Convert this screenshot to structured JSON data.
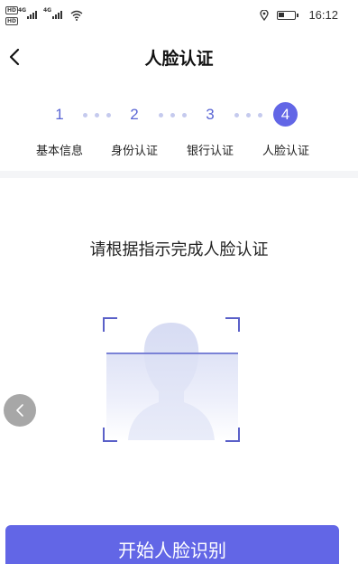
{
  "status_bar": {
    "hd_1": "HD",
    "hd_2": "HD",
    "network_1": "4G",
    "network_2": "4G",
    "time": "16:12",
    "icons": [
      "signal-icon",
      "wifi-icon",
      "location-icon",
      "battery-icon"
    ]
  },
  "nav": {
    "title": "人脸认证",
    "back_icon": "chevron-left-icon"
  },
  "steps": [
    {
      "number": "1",
      "label": "基本信息",
      "active": false
    },
    {
      "number": "2",
      "label": "身份认证",
      "active": false
    },
    {
      "number": "3",
      "label": "银行认证",
      "active": false
    },
    {
      "number": "4",
      "label": "人脸认证",
      "active": true
    }
  ],
  "main": {
    "instruction": "请根据指示完成人脸认证",
    "face_icon": "face-outline-icon"
  },
  "floating_back_icon": "chevron-left-icon",
  "action": {
    "start_label": "开始人脸识别"
  },
  "colors": {
    "accent": "#6266e6",
    "step_text": "#5a66d4",
    "dot": "#c5caee",
    "frame_corner": "#5a60c8"
  }
}
